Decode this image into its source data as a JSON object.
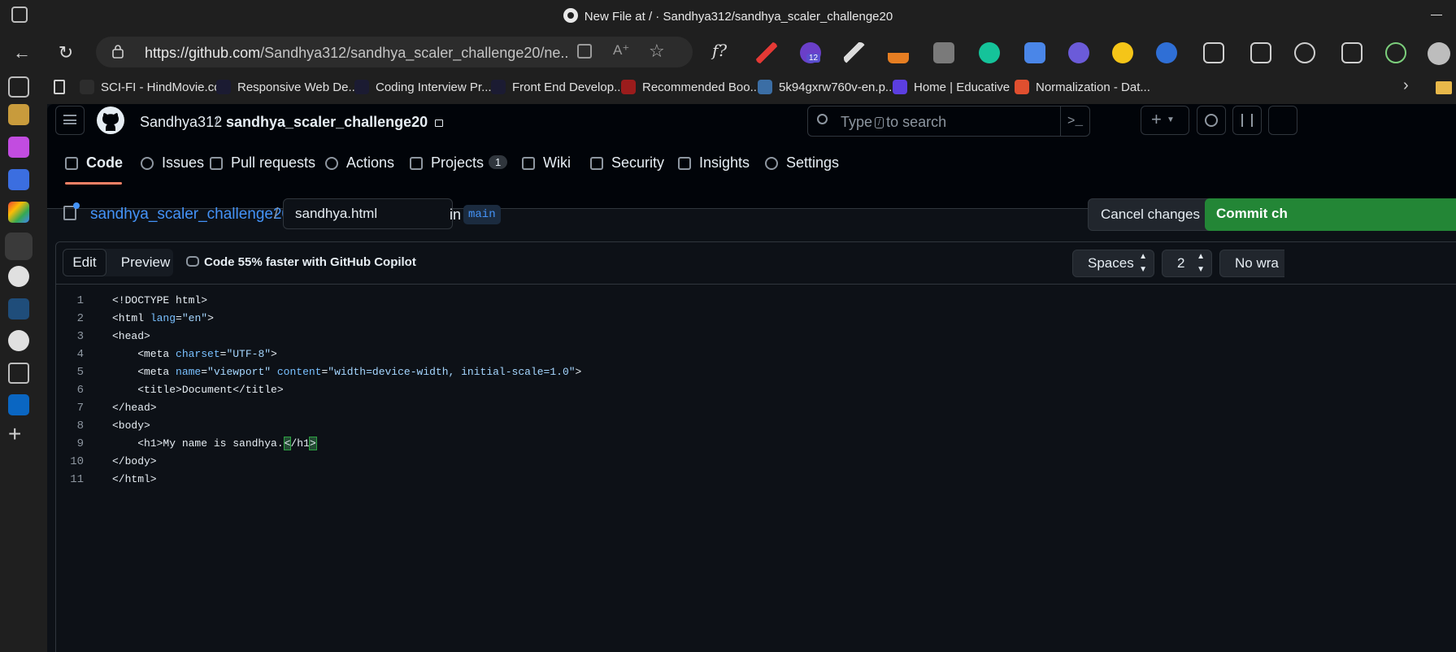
{
  "window": {
    "title": "New File at / · Sandhya312/sandhya_scaler_challenge20"
  },
  "browser": {
    "url_prefix": "https://github.com",
    "url_rest": "/Sandhya312/sandhya_scaler_challenge20/ne...",
    "extension_badge": "12",
    "bookmarks": [
      {
        "label": "SCI-FI - HindMovie.cc",
        "color": "#2d2d2d"
      },
      {
        "label": "Responsive Web De...",
        "color": "#1b1b32"
      },
      {
        "label": "Coding Interview Pr...",
        "color": "#1b1b32"
      },
      {
        "label": "Front End Develop...",
        "color": "#1b1b32"
      },
      {
        "label": "Recommended Boo...",
        "color": "#9b1c1c"
      },
      {
        "label": "5k94gxrw760v-en.p...",
        "color": "#3b6ea5"
      },
      {
        "label": "Home | Educative",
        "color": "#5b3ee0"
      },
      {
        "label": "Normalization - Dat...",
        "color": "#e04f2f"
      }
    ]
  },
  "github": {
    "owner": "Sandhya312",
    "separator": "/",
    "repo": "sandhya_scaler_challenge20",
    "search_placeholder_pre": "Type",
    "search_key": "/",
    "search_placeholder_post": "to search",
    "nav": [
      {
        "label": "Code",
        "icon": "code-icon"
      },
      {
        "label": "Issues",
        "icon": "issue-icon"
      },
      {
        "label": "Pull requests",
        "icon": "pull-request-icon"
      },
      {
        "label": "Actions",
        "icon": "play-icon"
      },
      {
        "label": "Projects",
        "icon": "table-icon",
        "count": "1"
      },
      {
        "label": "Wiki",
        "icon": "book-icon"
      },
      {
        "label": "Security",
        "icon": "shield-icon"
      },
      {
        "label": "Insights",
        "icon": "graph-icon"
      },
      {
        "label": "Settings",
        "icon": "gear-icon"
      }
    ],
    "breadcrumb_repo": "sandhya_scaler_challenge20",
    "breadcrumb_sep": "/",
    "filename": "sandhya.html",
    "in_label": "in",
    "branch": "main",
    "cancel_label": "Cancel changes",
    "commit_label": "Commit ch",
    "editor": {
      "tab_edit": "Edit",
      "tab_preview": "Preview",
      "copilot": "Code 55% faster with GitHub Copilot",
      "indent_mode": "Spaces",
      "indent_size": "2",
      "wrap_mode": "No wra"
    },
    "code_lines": [
      "1",
      "2",
      "3",
      "4",
      "5",
      "6",
      "7",
      "8",
      "9",
      "10",
      "11"
    ]
  },
  "colors": {
    "accent_blue": "#4493f8",
    "commit_green": "#238636",
    "underline_orange": "#f78166"
  }
}
